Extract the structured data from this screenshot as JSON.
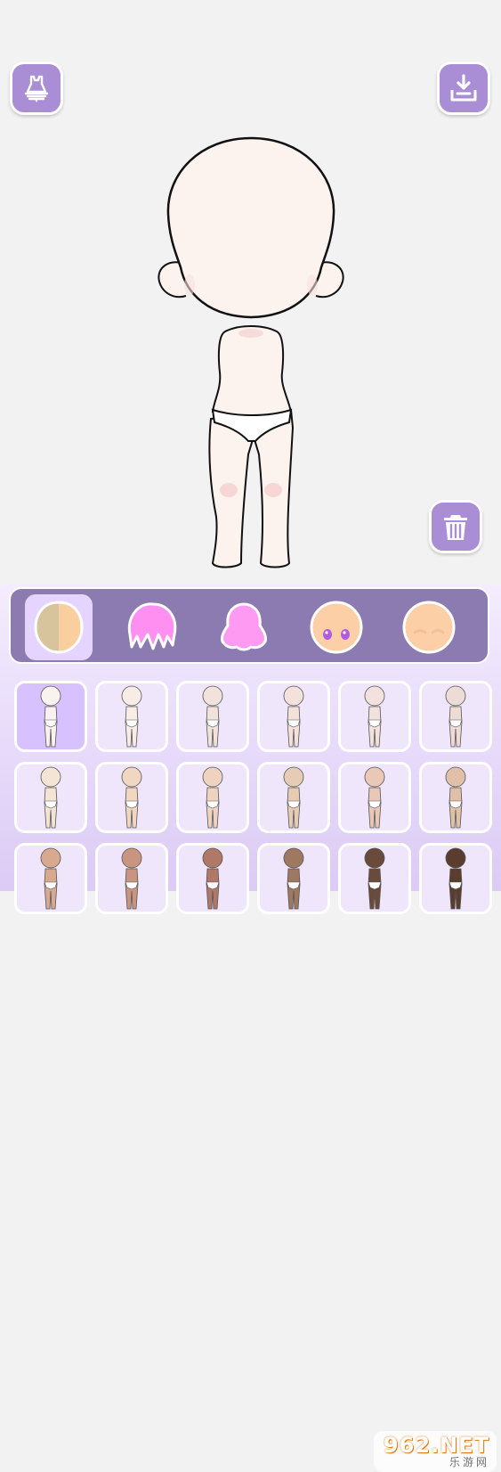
{
  "toolbar": {
    "outfit_button": {
      "icon": "outfit-icon"
    },
    "save_button": {
      "icon": "download-icon"
    },
    "trash_button": {
      "icon": "trash-icon"
    }
  },
  "colors": {
    "accent": "#a98ed6",
    "tabbar": "#8b7bb0",
    "tab_active": "#e4d4ff",
    "skin_base": "#fcf3ef"
  },
  "tabs": [
    {
      "name": "skin",
      "icon": "skin-tone-icon",
      "active": true
    },
    {
      "name": "hair",
      "icon": "hair-icon",
      "active": false
    },
    {
      "name": "back-hair",
      "icon": "back-hair-icon",
      "active": false
    },
    {
      "name": "eyes",
      "icon": "eyes-icon",
      "active": false
    },
    {
      "name": "face",
      "icon": "face-icon",
      "active": false
    }
  ],
  "skin_tones": [
    "#faf2ef",
    "#f9ece6",
    "#f1e3dc",
    "#f5e1db",
    "#f2e1dc",
    "#eddcd6",
    "#f4e4d4",
    "#f1d7c1",
    "#efd3c0",
    "#e6ccb5",
    "#e9c8b7",
    "#e0c0a8",
    "#d8a88f",
    "#c99580",
    "#b07866",
    "#9e7860",
    "#6a4a3a",
    "#5a3d2e"
  ],
  "selected_skin_index": 0,
  "watermark": {
    "brand": "962.NET",
    "sub": "乐游网"
  }
}
